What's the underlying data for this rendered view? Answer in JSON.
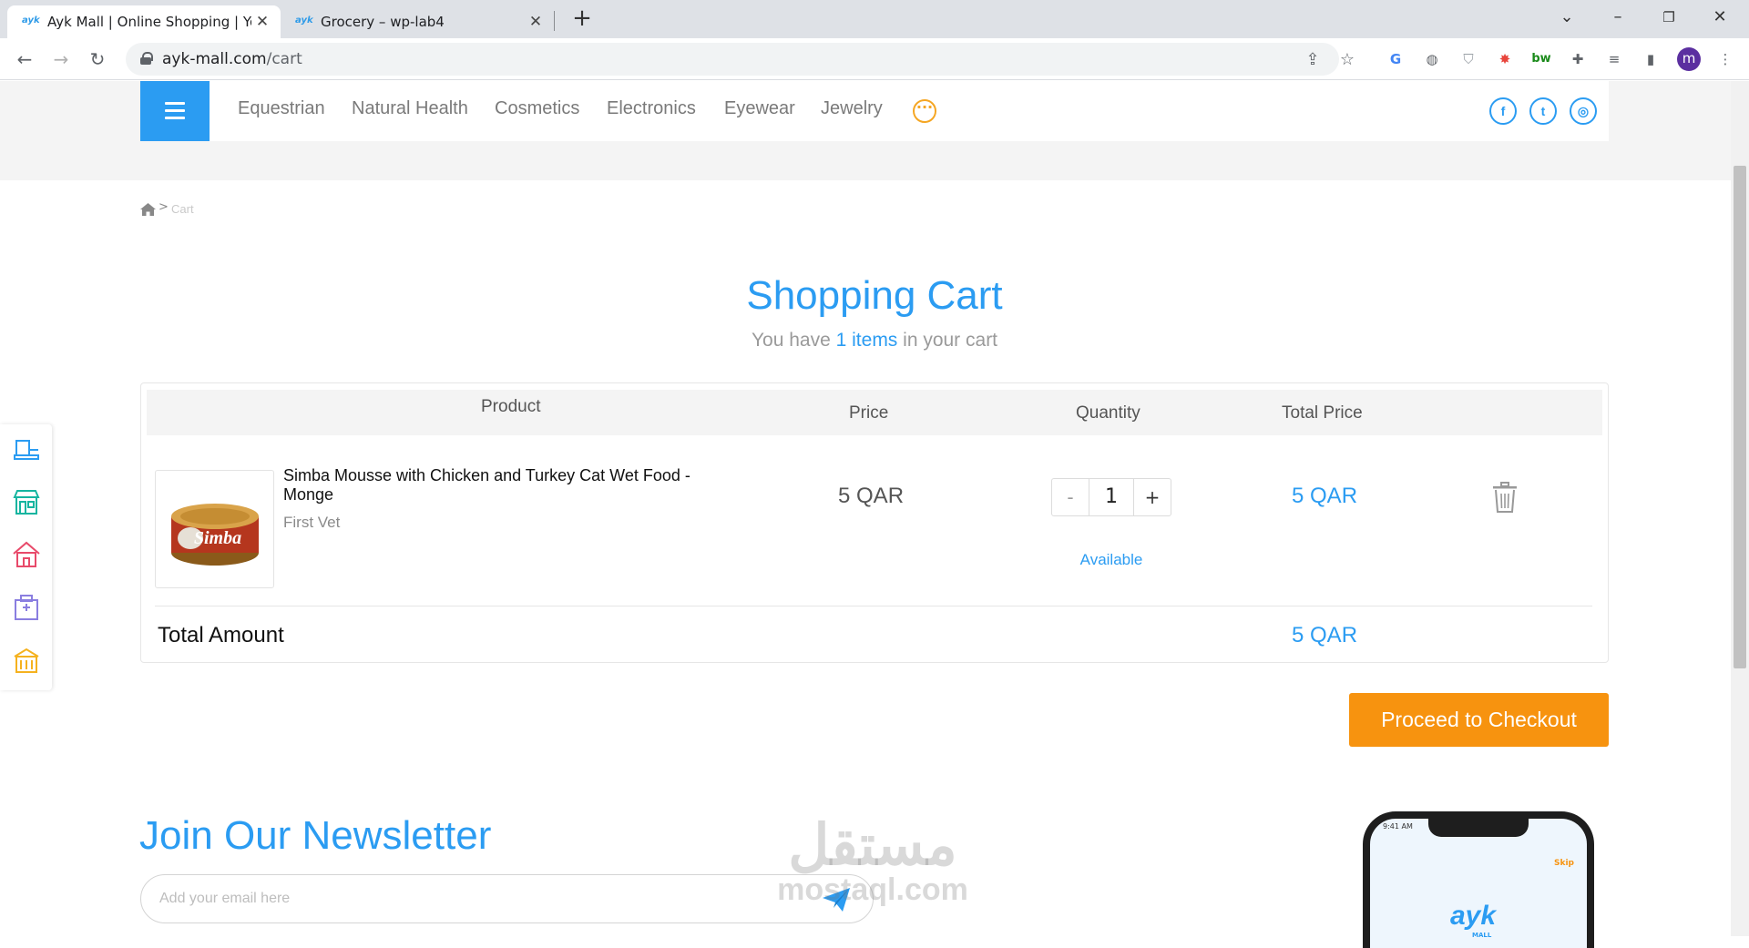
{
  "browser": {
    "tabs": [
      {
        "title": "Ayk Mall | Online Shopping | Your",
        "favicon": "ayk-favicon",
        "active": true
      },
      {
        "title": "Grocery – wp-lab4",
        "favicon": "ayk-favicon",
        "active": false
      }
    ],
    "favicon_text": "ayk",
    "new_tab": "+",
    "window_controls": {
      "minimize": "–",
      "restore": "❐",
      "close": "✕",
      "tab_search": "⌄"
    },
    "nav": {
      "back": "←",
      "forward": "→",
      "reload": "↻"
    },
    "url_domain": "ayk-mall.com",
    "url_path": "/cart",
    "profile_initial": "m"
  },
  "site": {
    "categories": [
      "Equestrian",
      "Natural Health",
      "Cosmetics",
      "Electronics",
      "Eyewear",
      "Jewelry"
    ],
    "more_glyph": "···",
    "social": [
      {
        "name": "facebook",
        "glyph": "f"
      },
      {
        "name": "twitter",
        "glyph": "t"
      },
      {
        "name": "instagram",
        "glyph": "◎"
      }
    ],
    "accent": "#2b9cf2",
    "orange": "#f7930f"
  },
  "breadcrumb": {
    "separator": ">",
    "current": "Cart"
  },
  "cart": {
    "title": "Shopping Cart",
    "subtitle_before": "You have ",
    "subtitle_count": "1 items",
    "subtitle_after": " in your cart",
    "headers": {
      "product": "Product",
      "price": "Price",
      "quantity": "Quantity",
      "total": "Total Price"
    },
    "items": [
      {
        "name": "Simba Mousse with Chicken and Turkey Cat Wet Food - Monge",
        "seller": "First Vet",
        "price": "5 QAR",
        "quantity": "1",
        "total": "5 QAR",
        "availability": "Available",
        "thumb_brand": "Simba"
      }
    ],
    "qty_minus": "-",
    "qty_plus": "+",
    "total_label": "Total Amount",
    "total_value": "5 QAR",
    "checkout_label": "Proceed to Checkout"
  },
  "newsletter": {
    "title": "Join Our Newsletter",
    "placeholder": "Add your email here"
  },
  "watermark": {
    "arabic": "مستقل",
    "latin": "mostaql.com"
  },
  "phone_mockup": {
    "time": "9:41 AM",
    "skip": "Skip",
    "logo": "ayk",
    "logo_sub": "MALL"
  },
  "sidebar_icons": [
    "store-front-icon",
    "shop-icon",
    "home-icon",
    "hospital-icon",
    "school-icon"
  ]
}
